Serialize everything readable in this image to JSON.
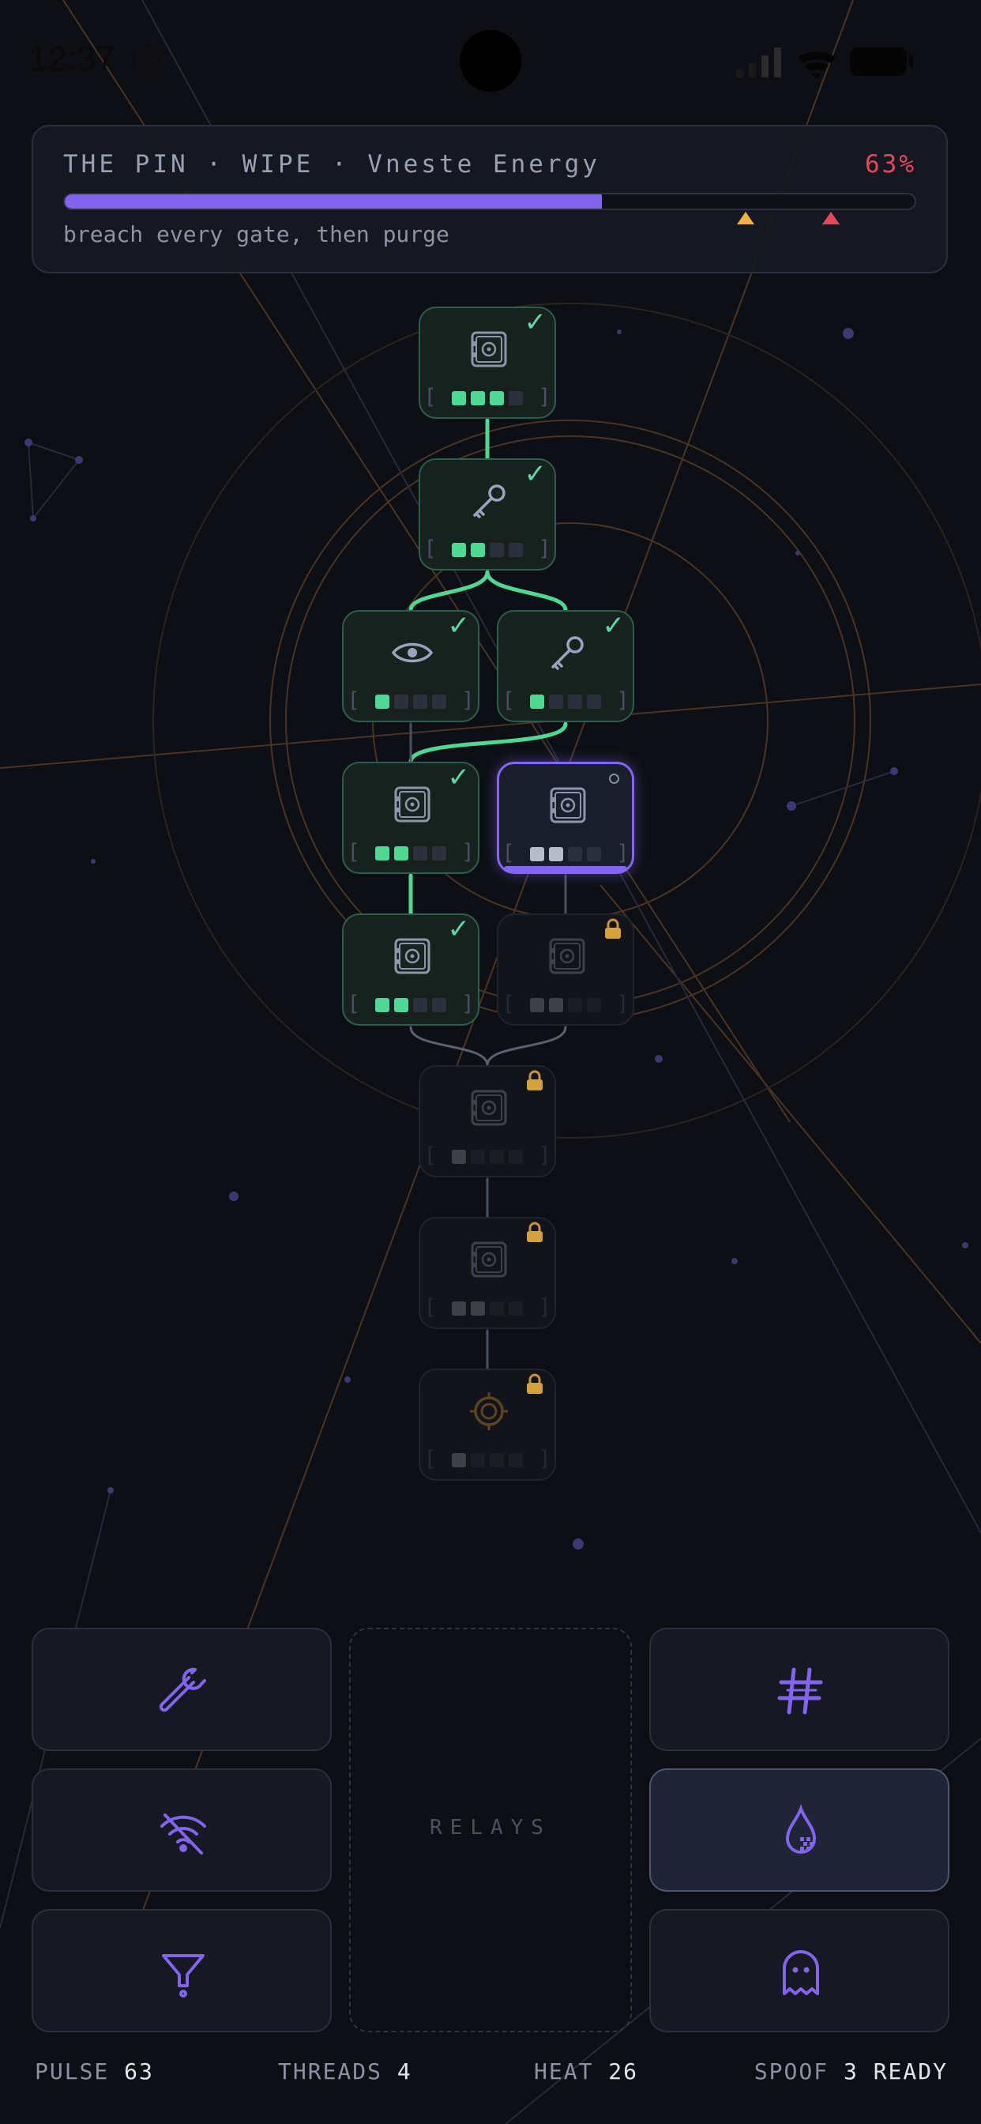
{
  "status": {
    "time": "12:37"
  },
  "mission": {
    "title": "THE PIN · WIPE · Vneste Energy",
    "percent_label": "63%",
    "progress": 0.63,
    "markers": [
      0.8,
      0.9
    ],
    "subtitle": "breach every gate, then purge"
  },
  "nodes": [
    {
      "id": "n1",
      "state": "done",
      "icon": "safe-icon",
      "pips": [
        "green",
        "green",
        "green",
        "off"
      ]
    },
    {
      "id": "n2",
      "state": "done",
      "icon": "key-icon",
      "pips": [
        "green",
        "green",
        "off",
        "off"
      ]
    },
    {
      "id": "n3",
      "state": "done",
      "icon": "eye-icon",
      "pips": [
        "green",
        "off",
        "off",
        "off"
      ]
    },
    {
      "id": "n4",
      "state": "done",
      "icon": "key-icon",
      "pips": [
        "green",
        "off",
        "off",
        "off"
      ]
    },
    {
      "id": "n5",
      "state": "done",
      "icon": "safe-icon",
      "pips": [
        "green",
        "green",
        "off",
        "off"
      ]
    },
    {
      "id": "n6",
      "state": "active",
      "icon": "safe-icon",
      "pips": [
        "gray",
        "gray",
        "off",
        "off"
      ]
    },
    {
      "id": "n7",
      "state": "done",
      "icon": "safe-icon",
      "pips": [
        "green",
        "green",
        "off",
        "off"
      ]
    },
    {
      "id": "n8",
      "state": "locked",
      "icon": "safe-icon",
      "pips": [
        "dim",
        "dim",
        "off",
        "off"
      ]
    },
    {
      "id": "n9",
      "state": "locked",
      "icon": "safe-icon",
      "pips": [
        "dim",
        "off",
        "off",
        "off"
      ]
    },
    {
      "id": "n10",
      "state": "locked",
      "icon": "safe-icon",
      "pips": [
        "dim",
        "dim",
        "off",
        "off"
      ]
    },
    {
      "id": "n11",
      "state": "locked",
      "icon": "target-icon",
      "pips": [
        "dim",
        "off",
        "off",
        "off"
      ]
    }
  ],
  "tools": [
    {
      "id": "wrench",
      "icon": "wrench-icon",
      "selected": false
    },
    {
      "id": "hash",
      "icon": "hash-icon",
      "selected": false
    },
    {
      "id": "no-signal",
      "icon": "signal-off-icon",
      "selected": false
    },
    {
      "id": "drop",
      "icon": "drop-icon",
      "selected": true
    },
    {
      "id": "funnel",
      "icon": "funnel-icon",
      "selected": false
    },
    {
      "id": "ghost",
      "icon": "ghost-icon",
      "selected": false
    }
  ],
  "relays": {
    "label": "RELAYS"
  },
  "stats": {
    "pulse": {
      "label": "PULSE",
      "value": "63"
    },
    "threads": {
      "label": "THREADS",
      "value": "4"
    },
    "heat": {
      "label": "HEAT",
      "value": "26"
    },
    "spoof": {
      "label": "SPOOF",
      "value": "3",
      "suffix": "READY"
    }
  },
  "colors": {
    "accent": "#8264ee",
    "done": "#4ed893",
    "danger": "#e8475a",
    "warn": "#f5b042"
  }
}
